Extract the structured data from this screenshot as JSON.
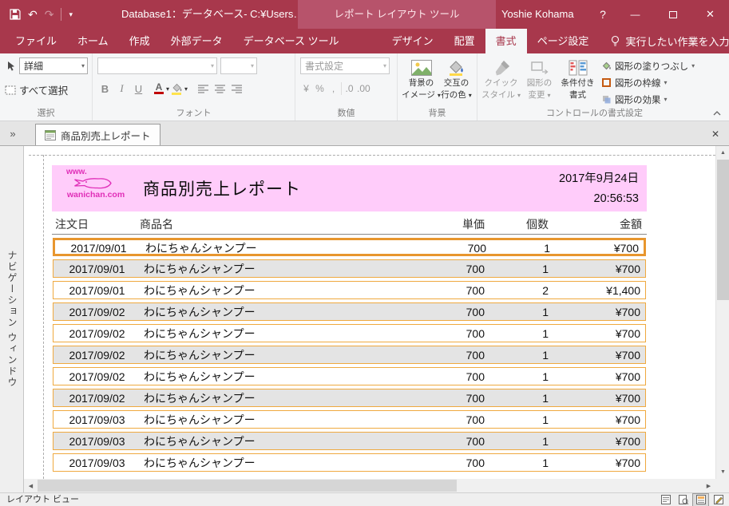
{
  "titlebar": {
    "app_title": "Database1：データベース- C:¥Users…",
    "context_label": "レポート レイアウト ツール",
    "user_name": "Yoshie Kohama"
  },
  "ribbon": {
    "tabs": [
      {
        "label": "ファイル"
      },
      {
        "label": "ホーム"
      },
      {
        "label": "作成"
      },
      {
        "label": "外部データ"
      },
      {
        "label": "データベース ツール"
      },
      {
        "label": "デザイン"
      },
      {
        "label": "配置"
      },
      {
        "label": "書式"
      },
      {
        "label": "ページ設定"
      }
    ],
    "active_tab": "書式",
    "tell_me": "実行したい作業を入力してください",
    "groups": {
      "selection": {
        "label": "選択",
        "object_combo_value": "詳細",
        "select_all_label": "すべて選択"
      },
      "font": {
        "label": "フォント",
        "bold": "B",
        "italic": "I",
        "underline": "U",
        "font_color_letter": "A"
      },
      "number": {
        "label": "数値",
        "format_combo_value": "書式設定",
        "currency": "¥",
        "percent": "%",
        "comma": ",",
        "dec_down": ".0",
        "dec_up": ".00"
      },
      "background": {
        "label": "背景",
        "image_line1": "背景の",
        "image_line2": "イメージ",
        "altrow_line1": "交互の",
        "altrow_line2": "行の色"
      },
      "control": {
        "label": "コントロールの書式設定",
        "quick_line1": "クイック",
        "quick_line2": "スタイル",
        "shape_line1": "図形の",
        "shape_line2": "変更",
        "cond_line1": "条件付き",
        "cond_line2": "書式",
        "fill_label": "図形の塗りつぶし",
        "outline_label": "図形の枠線",
        "effects_label": "図形の効果"
      }
    }
  },
  "document": {
    "tab_title": "商品別売上レポート"
  },
  "navigation_pane": {
    "title": "ナビゲーション ウィンドウ"
  },
  "report": {
    "logo_top": "www.",
    "logo_bottom": "wanichan.com",
    "title": "商品別売上レポート",
    "date": "2017年9月24日",
    "time": "20:56:53",
    "columns": [
      "注文日",
      "商品名",
      "単価",
      "個数",
      "金額"
    ],
    "selected_row_index": 0,
    "rows": [
      [
        "2017/09/01",
        "わにちゃんシャンプー",
        "700",
        "1",
        "¥700"
      ],
      [
        "2017/09/01",
        "わにちゃんシャンプー",
        "700",
        "1",
        "¥700"
      ],
      [
        "2017/09/01",
        "わにちゃんシャンプー",
        "700",
        "2",
        "¥1,400"
      ],
      [
        "2017/09/02",
        "わにちゃんシャンプー",
        "700",
        "1",
        "¥700"
      ],
      [
        "2017/09/02",
        "わにちゃんシャンプー",
        "700",
        "1",
        "¥700"
      ],
      [
        "2017/09/02",
        "わにちゃんシャンプー",
        "700",
        "1",
        "¥700"
      ],
      [
        "2017/09/02",
        "わにちゃんシャンプー",
        "700",
        "1",
        "¥700"
      ],
      [
        "2017/09/02",
        "わにちゃんシャンプー",
        "700",
        "1",
        "¥700"
      ],
      [
        "2017/09/03",
        "わにちゃんシャンプー",
        "700",
        "1",
        "¥700"
      ],
      [
        "2017/09/03",
        "わにちゃんシャンプー",
        "700",
        "1",
        "¥700"
      ],
      [
        "2017/09/03",
        "わにちゃんシャンプー",
        "700",
        "1",
        "¥700"
      ]
    ]
  },
  "status_bar": {
    "view_label": "レイアウト ビュー"
  },
  "colors": {
    "accent": "#A8384C",
    "contextual_header": "#B7536B",
    "report_header_pink": "#FFCCFA",
    "row_border_orange": "#EFA93F",
    "selected_row_border": "#E8962E",
    "alt_row_gray": "#E4E4E4"
  }
}
